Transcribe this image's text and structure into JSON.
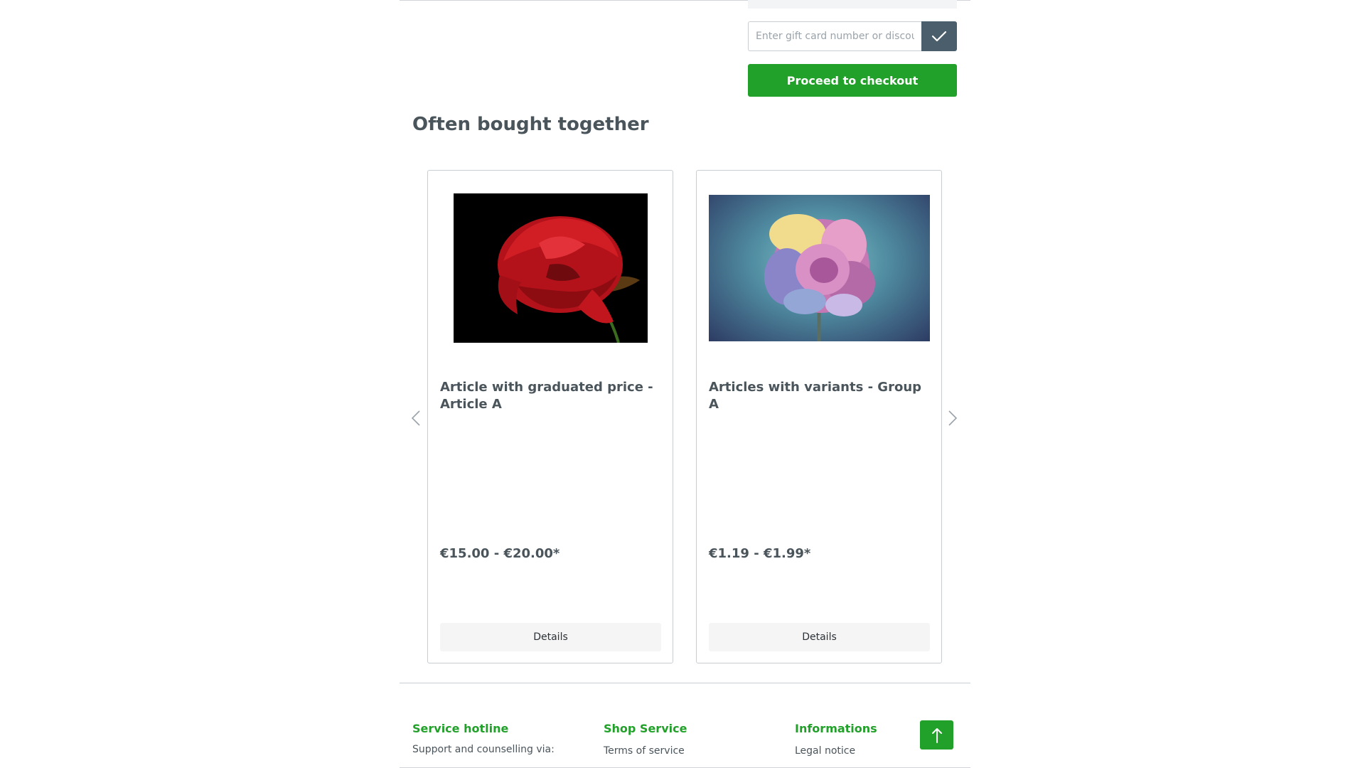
{
  "voucher": {
    "placeholder": "Enter gift card number or discount code",
    "submit_icon": "checkmark-icon"
  },
  "checkout": {
    "label": "Proceed to checkout"
  },
  "cross_selling": {
    "title": "Often bought together",
    "prev_icon": "chevron-left-icon",
    "next_icon": "chevron-right-icon",
    "products": [
      {
        "name": "Article with graduated price - Article A",
        "price": "€15.00 - €20.00*",
        "details_label": "Details"
      },
      {
        "name": "Articles with variants - Group A",
        "price": "€1.19 - €1.99*",
        "details_label": "Details"
      }
    ]
  },
  "footer": {
    "columns": [
      {
        "title": "Service hotline",
        "text": "Support and counselling via:"
      },
      {
        "title": "Shop Service",
        "text": "Terms of service"
      },
      {
        "title": "Informations",
        "text": "Legal notice"
      }
    ],
    "to_top_icon": "arrow-up-icon"
  },
  "colors": {
    "accent": "#22a12a",
    "voucher_button": "#4b5e6b",
    "text": "#4a545b"
  }
}
